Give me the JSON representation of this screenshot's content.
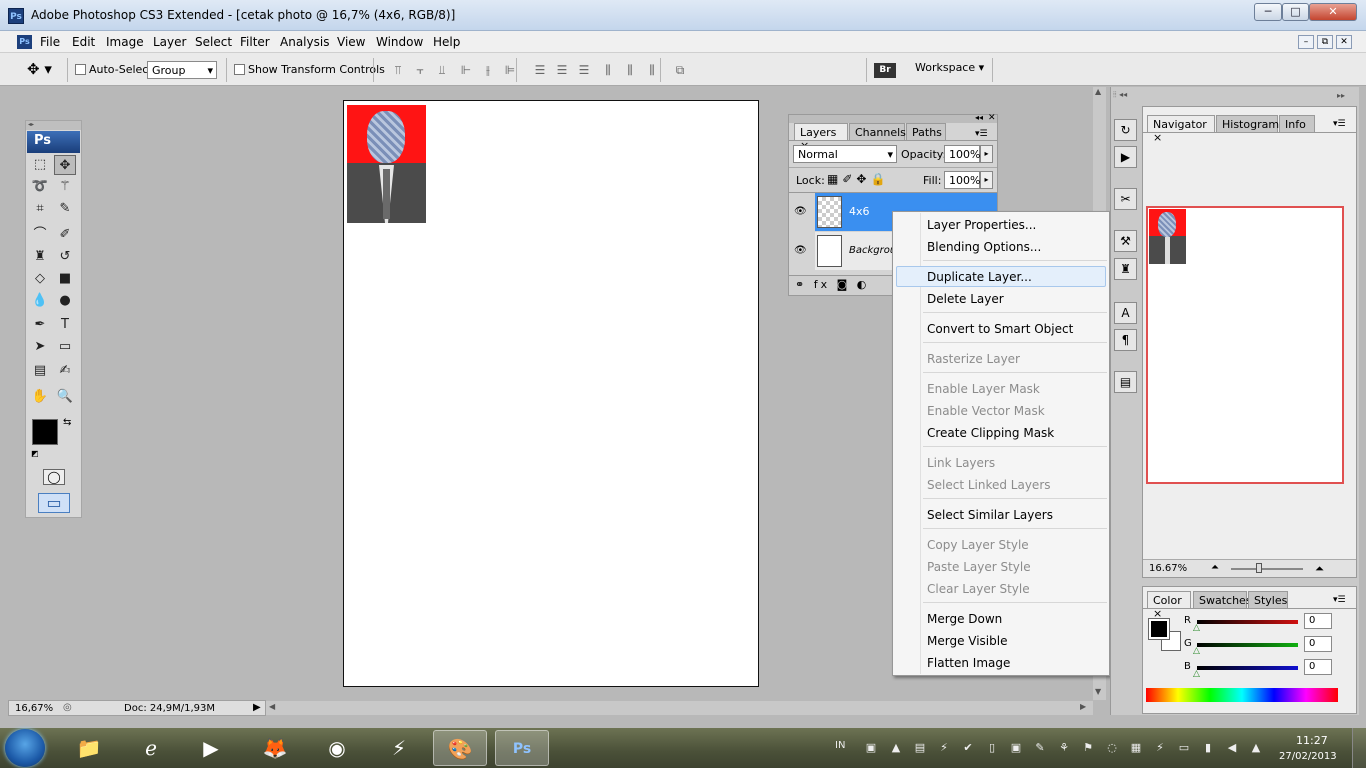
{
  "window": {
    "app_icon": "Ps",
    "title": "Adobe Photoshop CS3 Extended - [cetak photo @ 16,7% (4x6, RGB/8)]",
    "minimize": "─",
    "maximize": "□",
    "close": "✕"
  },
  "menubar": {
    "icon": "Ps",
    "items": [
      "File",
      "Edit",
      "Image",
      "Layer",
      "Select",
      "Filter",
      "Analysis",
      "View",
      "Window",
      "Help"
    ],
    "doc_minimize": "–",
    "doc_restore": "⧉",
    "doc_close": "✕"
  },
  "options": {
    "auto_select_label": "Auto-Select:",
    "auto_select_value": "Group",
    "show_transform_label": "Show Transform Controls",
    "workspace_label": "Workspace ▾",
    "bridge_icon": "Br"
  },
  "toolbox": {
    "logo": "Ps",
    "tools": [
      {
        "name": "marquee-tool-icon",
        "glyph": "⬚"
      },
      {
        "name": "move-tool-icon",
        "glyph": "✥"
      },
      {
        "name": "lasso-tool-icon",
        "glyph": "➰"
      },
      {
        "name": "magic-wand-icon",
        "glyph": "⚚"
      },
      {
        "name": "crop-tool-icon",
        "glyph": "⌗"
      },
      {
        "name": "slice-tool-icon",
        "glyph": "✎"
      },
      {
        "name": "healing-brush-icon",
        "glyph": "⌒"
      },
      {
        "name": "brush-tool-icon",
        "glyph": "✐"
      },
      {
        "name": "clone-stamp-icon",
        "glyph": "♜"
      },
      {
        "name": "history-brush-icon",
        "glyph": "↺"
      },
      {
        "name": "eraser-tool-icon",
        "glyph": "◇"
      },
      {
        "name": "gradient-tool-icon",
        "glyph": "■"
      },
      {
        "name": "blur-tool-icon",
        "glyph": "💧"
      },
      {
        "name": "dodge-tool-icon",
        "glyph": "●"
      },
      {
        "name": "pen-tool-icon",
        "glyph": "✒"
      },
      {
        "name": "type-tool-icon",
        "glyph": "T"
      },
      {
        "name": "path-select-icon",
        "glyph": "➤"
      },
      {
        "name": "shape-tool-icon",
        "glyph": "▭"
      },
      {
        "name": "notes-tool-icon",
        "glyph": "▤"
      },
      {
        "name": "eyedropper-icon",
        "glyph": "✍"
      },
      {
        "name": "hand-tool-icon",
        "glyph": "✋"
      },
      {
        "name": "zoom-tool-icon",
        "glyph": "🔍"
      }
    ],
    "quick_mask_glyph": "◯",
    "screen_mode_glyph": "▭"
  },
  "layers_panel": {
    "tabs": [
      "Layers",
      "Channels",
      "Paths"
    ],
    "tab_close": "×",
    "blend_mode": "Normal",
    "opacity_label": "Opacity:",
    "opacity_value": "100%",
    "lock_label": "Lock:",
    "fill_label": "Fill:",
    "fill_value": "100%",
    "layers": [
      {
        "name": "4x6",
        "selected": true
      },
      {
        "name": "Backgrou",
        "selected": false
      }
    ],
    "eye_glyph": "👁",
    "footer_icons": "⚭  fx  ◙  ◐"
  },
  "context_menu": {
    "items": [
      {
        "label": "Layer Properties...",
        "enabled": true
      },
      {
        "label": "Blending Options...",
        "enabled": true
      },
      {
        "label": "Duplicate Layer...",
        "enabled": true,
        "highlighted": true
      },
      {
        "label": "Delete Layer",
        "enabled": true
      },
      {
        "label": "Convert to Smart Object",
        "enabled": true
      },
      {
        "label": "Rasterize Layer",
        "enabled": false
      },
      {
        "label": "Enable Layer Mask",
        "enabled": false
      },
      {
        "label": "Enable Vector Mask",
        "enabled": false
      },
      {
        "label": "Create Clipping Mask",
        "enabled": true
      },
      {
        "label": "Link Layers",
        "enabled": false
      },
      {
        "label": "Select Linked Layers",
        "enabled": false
      },
      {
        "label": "Select Similar Layers",
        "enabled": true
      },
      {
        "label": "Copy Layer Style",
        "enabled": false
      },
      {
        "label": "Paste Layer Style",
        "enabled": false
      },
      {
        "label": "Clear Layer Style",
        "enabled": false
      },
      {
        "label": "Merge Down",
        "enabled": true
      },
      {
        "label": "Merge Visible",
        "enabled": true
      },
      {
        "label": "Flatten Image",
        "enabled": true
      }
    ]
  },
  "status": {
    "zoom": "16,67%",
    "doc_size": "Doc: 24,9M/1,93M"
  },
  "navigator_panel": {
    "tabs": [
      "Navigator",
      "Histogram",
      "Info"
    ],
    "zoom_value": "16.67%"
  },
  "color_panel": {
    "tabs": [
      "Color",
      "Swatches",
      "Styles"
    ],
    "channels": [
      {
        "label": "R",
        "value": "0",
        "color": "#d01010"
      },
      {
        "label": "G",
        "value": "0",
        "color": "#10b010"
      },
      {
        "label": "B",
        "value": "0",
        "color": "#1010d0"
      }
    ]
  },
  "taskbar": {
    "apps": [
      {
        "name": "explorer-taskbar-icon",
        "glyph": "📁",
        "active": false
      },
      {
        "name": "ie-taskbar-icon",
        "glyph": "ℯ",
        "active": false
      },
      {
        "name": "media-player-taskbar-icon",
        "glyph": "▶",
        "active": false
      },
      {
        "name": "firefox-taskbar-icon",
        "glyph": "🦊",
        "active": false
      },
      {
        "name": "chrome-taskbar-icon",
        "glyph": "◉",
        "active": false
      },
      {
        "name": "winamp-taskbar-icon",
        "glyph": "⚡",
        "active": false
      },
      {
        "name": "paint-taskbar-icon",
        "glyph": "🎨",
        "active": true
      },
      {
        "name": "photoshop-taskbar-icon",
        "glyph": "Ps",
        "active": true
      }
    ],
    "language": "IN",
    "time": "11:27",
    "date": "27/02/2013"
  }
}
